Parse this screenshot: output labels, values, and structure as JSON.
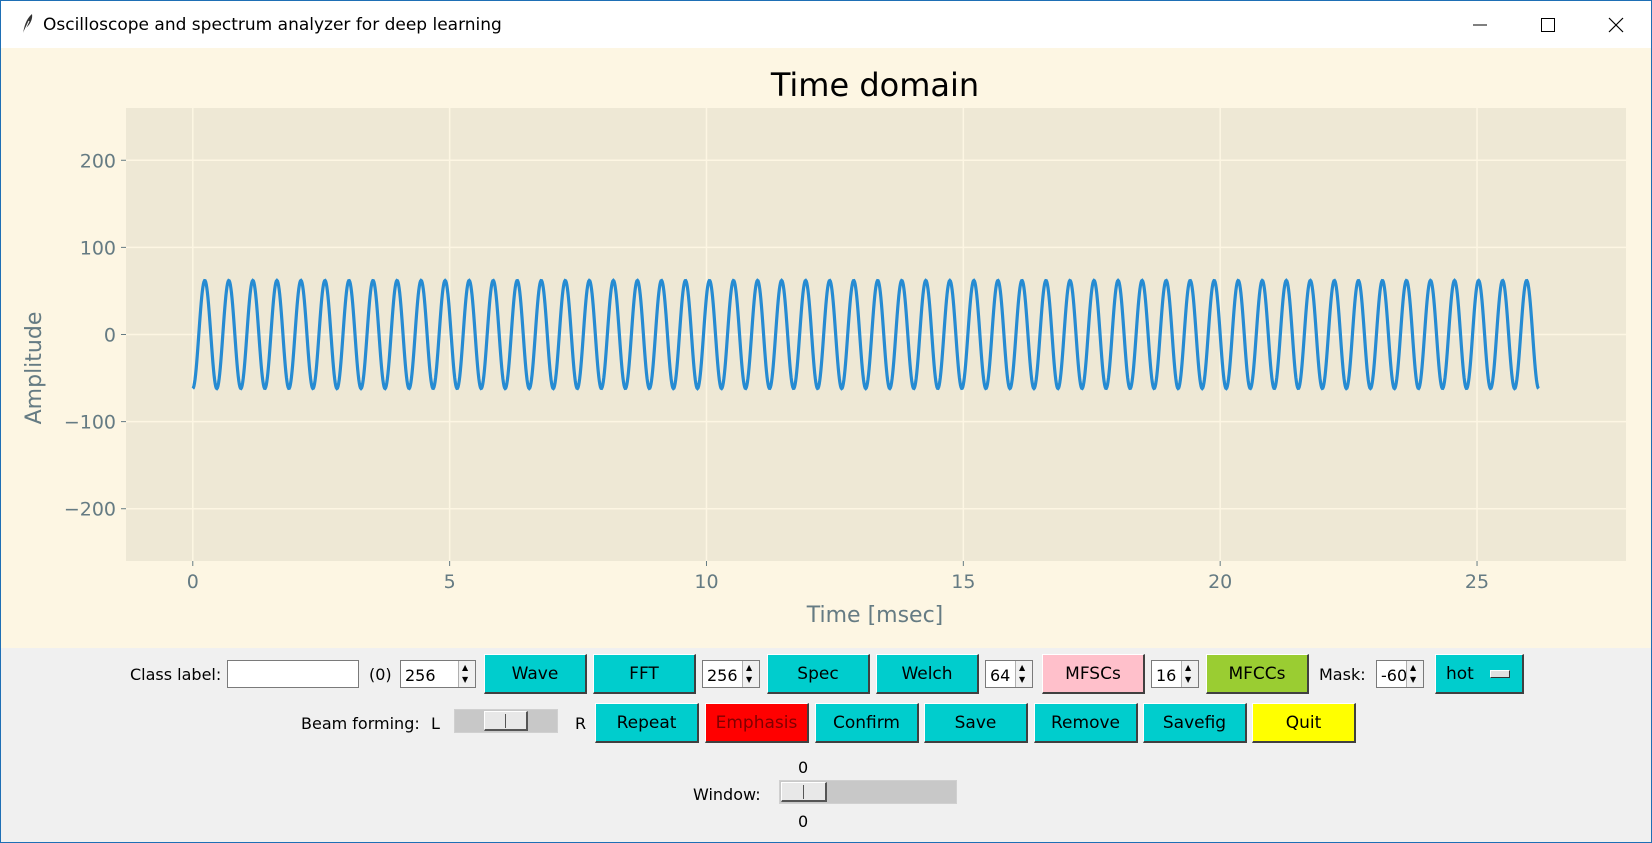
{
  "window": {
    "title": "Oscilloscope and spectrum analyzer for deep learning"
  },
  "chart_data": {
    "type": "line",
    "title": "Time domain",
    "xlabel": "Time [msec]",
    "ylabel": "Amplitude",
    "xlim": [
      -1.3,
      27.9
    ],
    "ylim": [
      -260,
      260
    ],
    "xticks": [
      "0",
      "5",
      "10",
      "15",
      "20",
      "25"
    ],
    "yticks": [
      "200",
      "100",
      "0",
      "−100",
      "−200"
    ],
    "grid": true,
    "series": [
      {
        "color": "#268bd2",
        "signal": "sine",
        "x_start": 0,
        "x_end": 26.2,
        "cycles": 56,
        "amplitude": 62,
        "start_value": -62,
        "end_value": -18
      }
    ]
  },
  "controls": {
    "class_label": {
      "label": "Class label:",
      "value": "",
      "count": "(0)"
    },
    "samples_spin": "256",
    "wave_button": "Wave",
    "fft_button": "FFT",
    "fft_spin": "256",
    "spec_button": "Spec",
    "welch_button": "Welch",
    "welch_spin": "64",
    "mfscs_button": "MFSCs",
    "mfscs_spin": "16",
    "mfccs_button": "MFCCs",
    "mask_label": "Mask:",
    "mask_spin": "-60",
    "colormap_menu": "hot",
    "beam_forming_label": "Beam forming:",
    "beam_left": "L",
    "beam_right": "R",
    "beam_level": 0.5,
    "repeat_button": "Repeat",
    "emphasis_button": "Emphasis",
    "confirm_button": "Confirm",
    "save_button": "Save",
    "remove_button": "Remove",
    "savefig_button": "Savefig",
    "quit_button": "Quit",
    "window_label": "Window:",
    "window_value_top": "0",
    "window_value_bottom": "0",
    "window_level": 0
  },
  "colors": {
    "cyan": "#00cdcd",
    "red": "#ff0000",
    "pink": "#ffc0cb",
    "green": "#9acd32",
    "yellow": "#ffff00",
    "plot_bg": "#eee8d5",
    "figure_bg": "#fdf6e3"
  }
}
